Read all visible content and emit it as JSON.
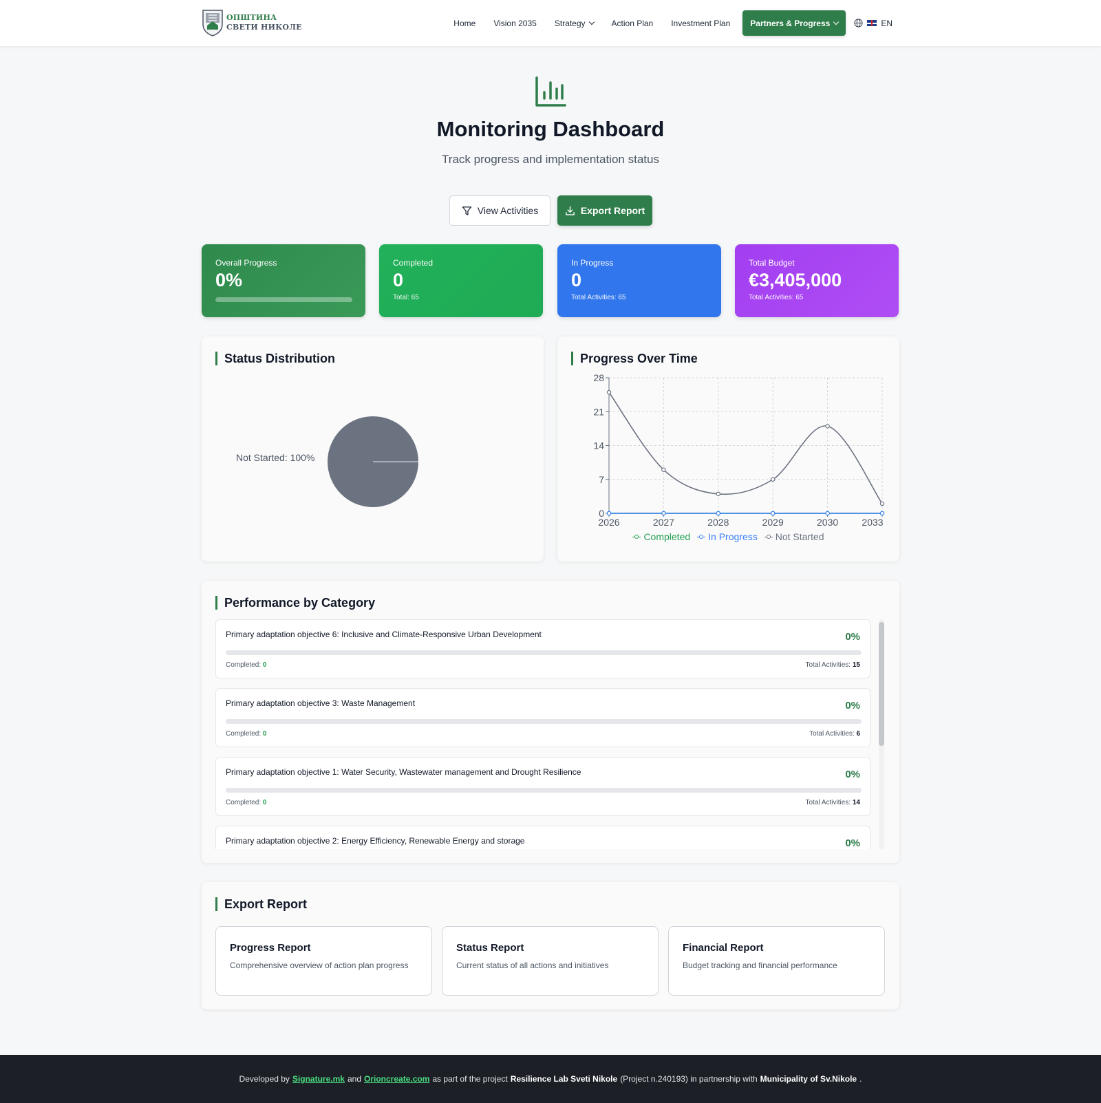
{
  "brand": {
    "line1": "ОПШТИНА",
    "line2": "СВЕТИ НИКОЛЕ"
  },
  "nav": {
    "items": [
      "Home",
      "Vision 2035",
      "Strategy",
      "Action Plan",
      "Investment Plan",
      "Partners & Progress"
    ],
    "lang": "EN"
  },
  "header": {
    "title": "Monitoring Dashboard",
    "subtitle": "Track progress and implementation status",
    "view_activities": "View Activities",
    "export_report": "Export Report"
  },
  "stats": {
    "overall": {
      "label": "Overall Progress",
      "value": "0%",
      "progress": 0
    },
    "completed": {
      "label": "Completed",
      "value": "0",
      "sub": "Total: 65"
    },
    "in_progress": {
      "label": "In Progress",
      "value": "0",
      "sub": "Total Activities: 65"
    },
    "budget": {
      "label": "Total Budget",
      "value": "€3,405,000",
      "sub": "Total Activities: 65"
    }
  },
  "status_panel": {
    "title": "Status Distribution",
    "pie_label": "Not Started: 100%"
  },
  "progress_panel": {
    "title": "Progress Over Time"
  },
  "chart_data": [
    {
      "type": "pie",
      "title": "Status Distribution",
      "categories": [
        "Not Started"
      ],
      "values": [
        100
      ],
      "colors": [
        "#6b7280"
      ]
    },
    {
      "type": "line",
      "title": "Progress Over Time",
      "x": [
        "2026",
        "2027",
        "2028",
        "2029",
        "2030",
        "2033"
      ],
      "ylim": [
        0,
        28
      ],
      "yticks": [
        0,
        7,
        14,
        21,
        28
      ],
      "grid": true,
      "legend": "bottom",
      "series": [
        {
          "name": "Completed",
          "values": [
            0,
            0,
            0,
            0,
            0,
            0
          ],
          "color": "#22a052"
        },
        {
          "name": "In Progress",
          "values": [
            0,
            0,
            0,
            0,
            0,
            0
          ],
          "color": "#3b82f6"
        },
        {
          "name": "Not Started",
          "values": [
            25,
            9,
            4,
            7,
            18,
            2
          ],
          "color": "#6b7280"
        }
      ]
    }
  ],
  "category_panel": {
    "title": "Performance by Category",
    "completed_label": "Completed:",
    "total_label": "Total Activities:",
    "items": [
      {
        "name": "Primary adaptation objective 6: Inclusive and Climate-Responsive Urban Development",
        "pct": "0%",
        "progress": 0,
        "completed": "0",
        "total": "15"
      },
      {
        "name": "Primary adaptation objective 3: Waste Management",
        "pct": "0%",
        "progress": 0,
        "completed": "0",
        "total": "6"
      },
      {
        "name": "Primary adaptation objective 1: Water Security, Wastewater management and Drought Resilience",
        "pct": "0%",
        "progress": 0,
        "completed": "0",
        "total": "14"
      },
      {
        "name": "Primary adaptation objective 2: Energy Efficiency, Renewable Energy and storage",
        "pct": "0%",
        "progress": 0,
        "completed": "",
        "total": ""
      }
    ]
  },
  "export_panel": {
    "title": "Export Report",
    "cards": [
      {
        "title": "Progress Report",
        "desc": "Comprehensive overview of action plan progress"
      },
      {
        "title": "Status Report",
        "desc": "Current status of all actions and initiatives"
      },
      {
        "title": "Financial Report",
        "desc": "Budget tracking and financial performance"
      }
    ]
  },
  "footer": {
    "prefix": "Developed by",
    "link1": "Signature.mk",
    "and": "and",
    "link2": "Orioncreate.com",
    "middle": "as part of the project",
    "project": "Resilience Lab Sveti Nikole",
    "project_no": "(Project n.240193) in partnership with",
    "partner": "Municipality of Sv.Nikole",
    "end": "."
  }
}
